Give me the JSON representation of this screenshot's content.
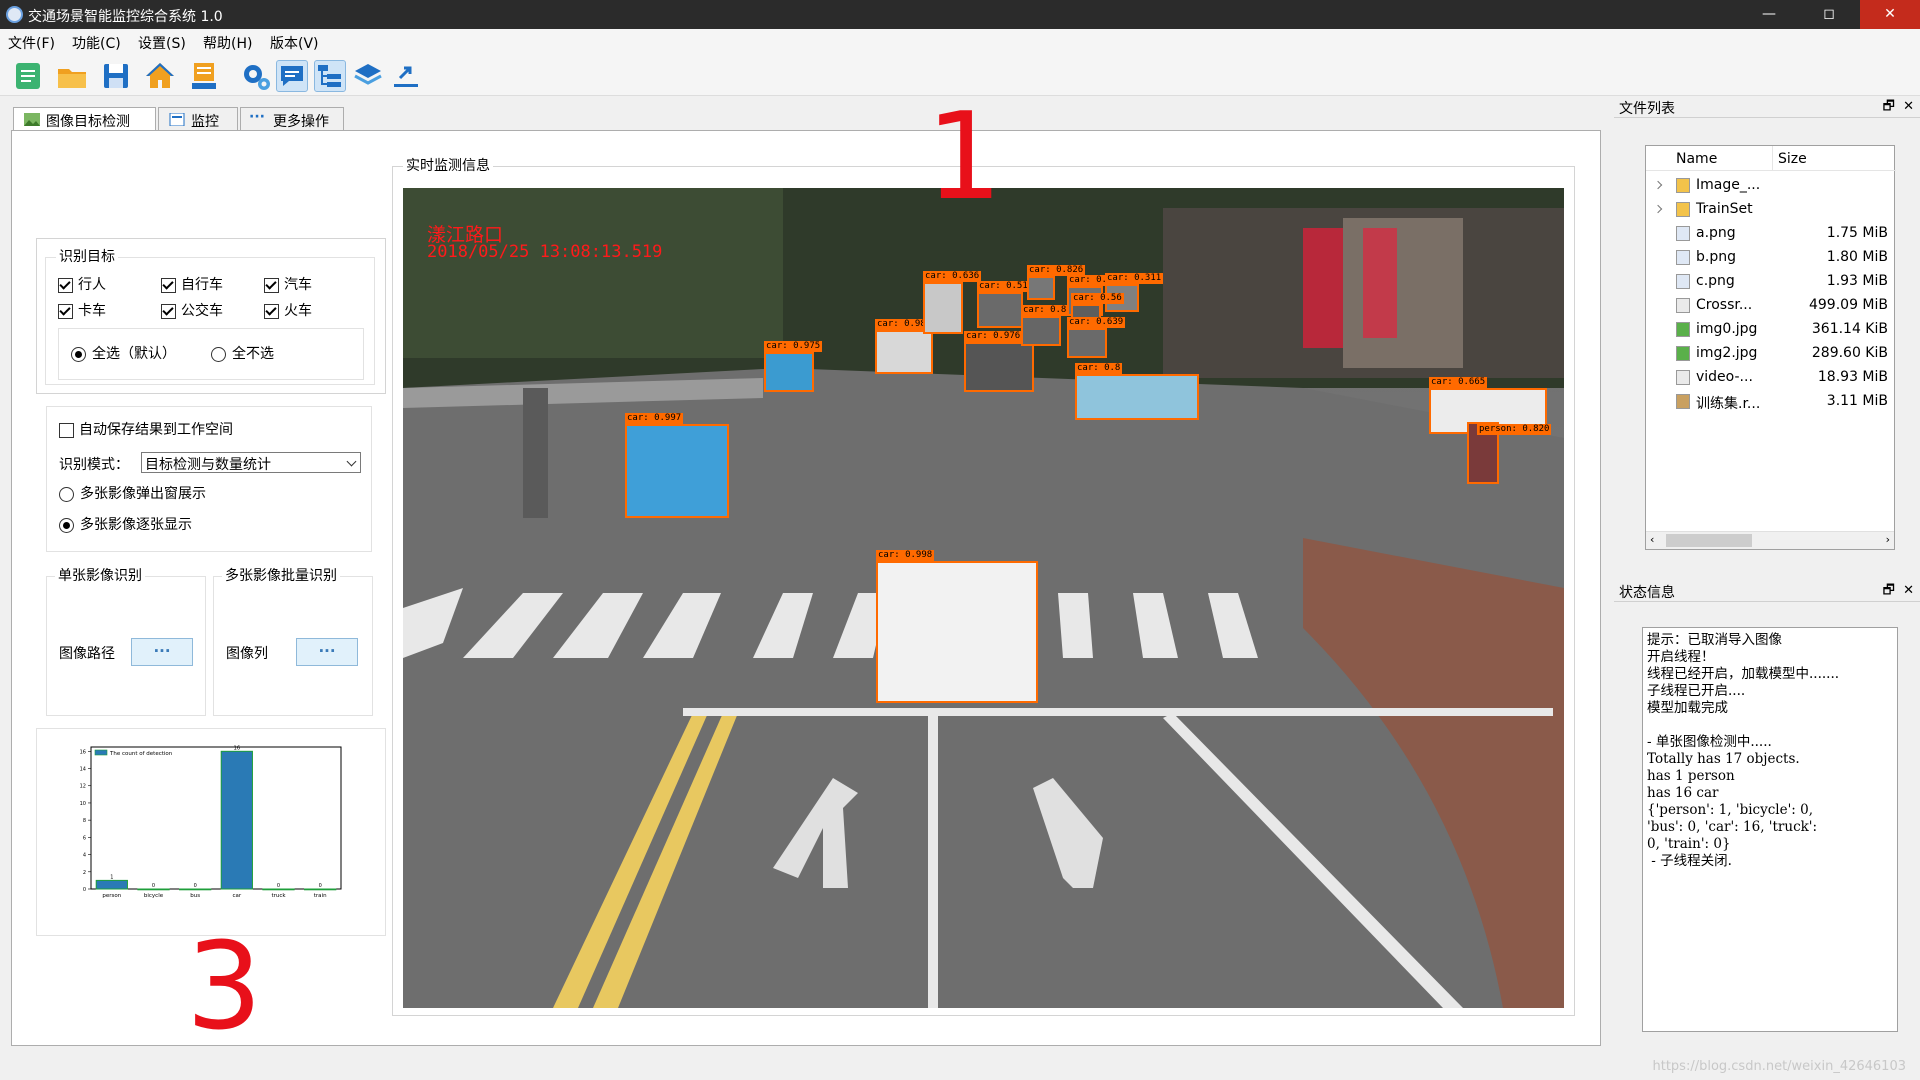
{
  "window": {
    "title": "交通场景智能监控综合系统 1.0",
    "min": "—",
    "max": "◻",
    "close": "✕"
  },
  "menu": [
    "文件(F)",
    "功能(C)",
    "设置(S)",
    "帮助(H)",
    "版本(V)"
  ],
  "toolbar_icons": [
    "new-icon",
    "open-folder-icon",
    "save-icon",
    "home-icon",
    "export-icon",
    "settings-icon",
    "message-icon",
    "tree-icon",
    "layers-icon",
    "link-icon"
  ],
  "tabs": [
    {
      "label": "图像目标检测",
      "icon": "image-icon"
    },
    {
      "label": "监控",
      "icon": "monitor-icon"
    },
    {
      "label": "更多操作",
      "icon": "more-icon"
    }
  ],
  "detect_targets": {
    "title": "识别目标",
    "items": [
      {
        "label": "行人",
        "checked": true
      },
      {
        "label": "自行车",
        "checked": true
      },
      {
        "label": "汽车",
        "checked": true
      },
      {
        "label": "卡车",
        "checked": true
      },
      {
        "label": "公交车",
        "checked": true
      },
      {
        "label": "火车",
        "checked": true
      }
    ],
    "select_all": "全选（默认）",
    "select_none": "全不选"
  },
  "options": {
    "autosave": "自动保存结果到工作空间",
    "mode_label": "识别模式：",
    "mode_value": "目标检测与数量统计",
    "popup": "多张影像弹出窗展示",
    "sequential": "多张影像逐张显示"
  },
  "single": {
    "title": "单张影像识别",
    "path_label": "图像路径",
    "button": "···"
  },
  "batch": {
    "title": "多张影像批量识别",
    "list_label": "图像列",
    "button": "···"
  },
  "monitor": {
    "title": "实时监测信息",
    "overlay_location": "漾江路口",
    "overlay_time": "2018/05/25 13:08:13.519",
    "detections": [
      {
        "label": "car: 0.975"
      },
      {
        "label": "car: 0.997"
      },
      {
        "label": "car: 0.998"
      },
      {
        "label": "car: 0.98"
      },
      {
        "label": "car: 0.636"
      },
      {
        "label": "car: 0.516"
      },
      {
        "label": "car: 0.826"
      },
      {
        "label": "car: 0.976"
      },
      {
        "label": "car: 0.886"
      },
      {
        "label": "car: 0.927"
      },
      {
        "label": "car: 0.311"
      },
      {
        "label": "car: 0.56"
      },
      {
        "label": "car: 0.639"
      },
      {
        "label": "car: 0.8"
      },
      {
        "label": "car: 0.665"
      },
      {
        "label": "person: 0.820"
      }
    ]
  },
  "chart_data": {
    "type": "bar",
    "categories": [
      "person",
      "bicycle",
      "bus",
      "car",
      "truck",
      "train"
    ],
    "values": [
      1,
      0,
      0,
      16,
      0,
      0
    ],
    "legend": "The count of detection",
    "yticks": [
      0,
      2,
      4,
      6,
      8,
      10,
      12,
      14,
      16
    ],
    "ylim": [
      0,
      16.5
    ],
    "bar_color": "#2a7ab5",
    "bar_edge": "#1e9e3a"
  },
  "file_panel": {
    "title": "文件列表",
    "col_name": "Name",
    "col_size": "Size",
    "files": [
      {
        "name": "Image_...",
        "size": "",
        "icon": "folder-icon",
        "expandable": true
      },
      {
        "name": "TrainSet",
        "size": "",
        "icon": "folder-icon",
        "expandable": true
      },
      {
        "name": "a.png",
        "size": "1.75 MiB",
        "icon": "png-file-icon"
      },
      {
        "name": "b.png",
        "size": "1.80 MiB",
        "icon": "png-file-icon"
      },
      {
        "name": "c.png",
        "size": "1.93 MiB",
        "icon": "png-file-icon"
      },
      {
        "name": "Crossr...",
        "size": "499.09 MiB",
        "icon": "file-icon"
      },
      {
        "name": "img0.jpg",
        "size": "361.14 KiB",
        "icon": "jpg-file-icon"
      },
      {
        "name": "img2.jpg",
        "size": "289.60 KiB",
        "icon": "jpg-file-icon"
      },
      {
        "name": "video-...",
        "size": "18.93 MiB",
        "icon": "file-icon"
      },
      {
        "name": "训练集.r...",
        "size": "3.11 MiB",
        "icon": "archive-icon"
      }
    ]
  },
  "status_panel": {
    "title": "状态信息",
    "text": "提示：已取消导入图像\n开启线程！\n线程已经开启，加载模型中.......\n子线程已开启....\n模型加载完成\n\n- 单张图像检测中.....\nTotally has 17 objects.\nhas 1 person\nhas 16 car\n{'person': 1, 'bicycle': 0,\n'bus': 0, 'car': 16, 'truck':\n0, 'train': 0}\n - 子线程关闭."
  },
  "annotations": [
    "1",
    "2",
    "3"
  ],
  "watermark": "https://blog.csdn.net/weixin_42646103"
}
